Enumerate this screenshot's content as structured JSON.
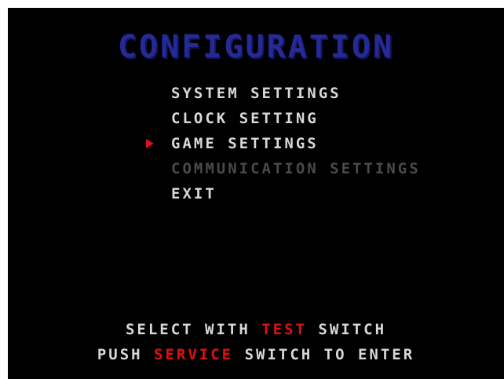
{
  "screen": {
    "title": "CONFIGURATION",
    "menu": [
      {
        "label": "SYSTEM SETTINGS",
        "enabled": true,
        "selected": false
      },
      {
        "label": "CLOCK SETTING",
        "enabled": true,
        "selected": false
      },
      {
        "label": "GAME SETTINGS",
        "enabled": true,
        "selected": true
      },
      {
        "label": "COMMUNICATION SETTINGS",
        "enabled": false,
        "selected": false
      },
      {
        "label": "EXIT",
        "enabled": true,
        "selected": false
      }
    ],
    "cursor_icon": "triangle-right-icon",
    "footer": {
      "line1": {
        "pre": "SELECT WITH ",
        "key": "TEST",
        "post": " SWITCH"
      },
      "line2": {
        "pre": "PUSH ",
        "key": "SERVICE",
        "post": " SWITCH TO ENTER"
      }
    },
    "colors": {
      "background": "#000000",
      "title": "#262a96",
      "text": "#d8d8d8",
      "disabled": "#4a4a4a",
      "highlight": "#e01010"
    }
  }
}
